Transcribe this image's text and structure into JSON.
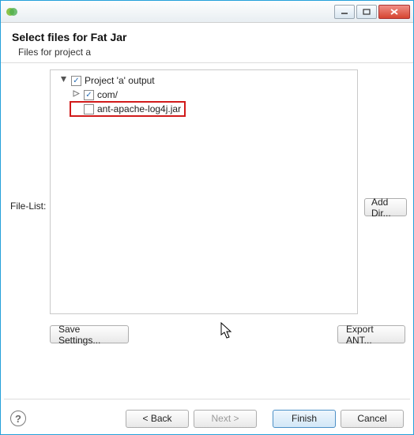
{
  "header": {
    "title": "Select files for Fat Jar",
    "subtitle": "Files for project a"
  },
  "labels": {
    "file_list": "File-List:"
  },
  "tree": {
    "root": {
      "label": "Project 'a' output",
      "checked": true,
      "expanded": true
    },
    "child1": {
      "label": "com/",
      "checked": true,
      "expanded": false
    },
    "child2": {
      "label": "ant-apache-log4j.jar",
      "checked": false
    }
  },
  "buttons": {
    "add_dir": "Add Dir...",
    "save_settings": "Save Settings...",
    "export_ant": "Export ANT...",
    "back": "< Back",
    "next": "Next >",
    "finish": "Finish",
    "cancel": "Cancel"
  }
}
